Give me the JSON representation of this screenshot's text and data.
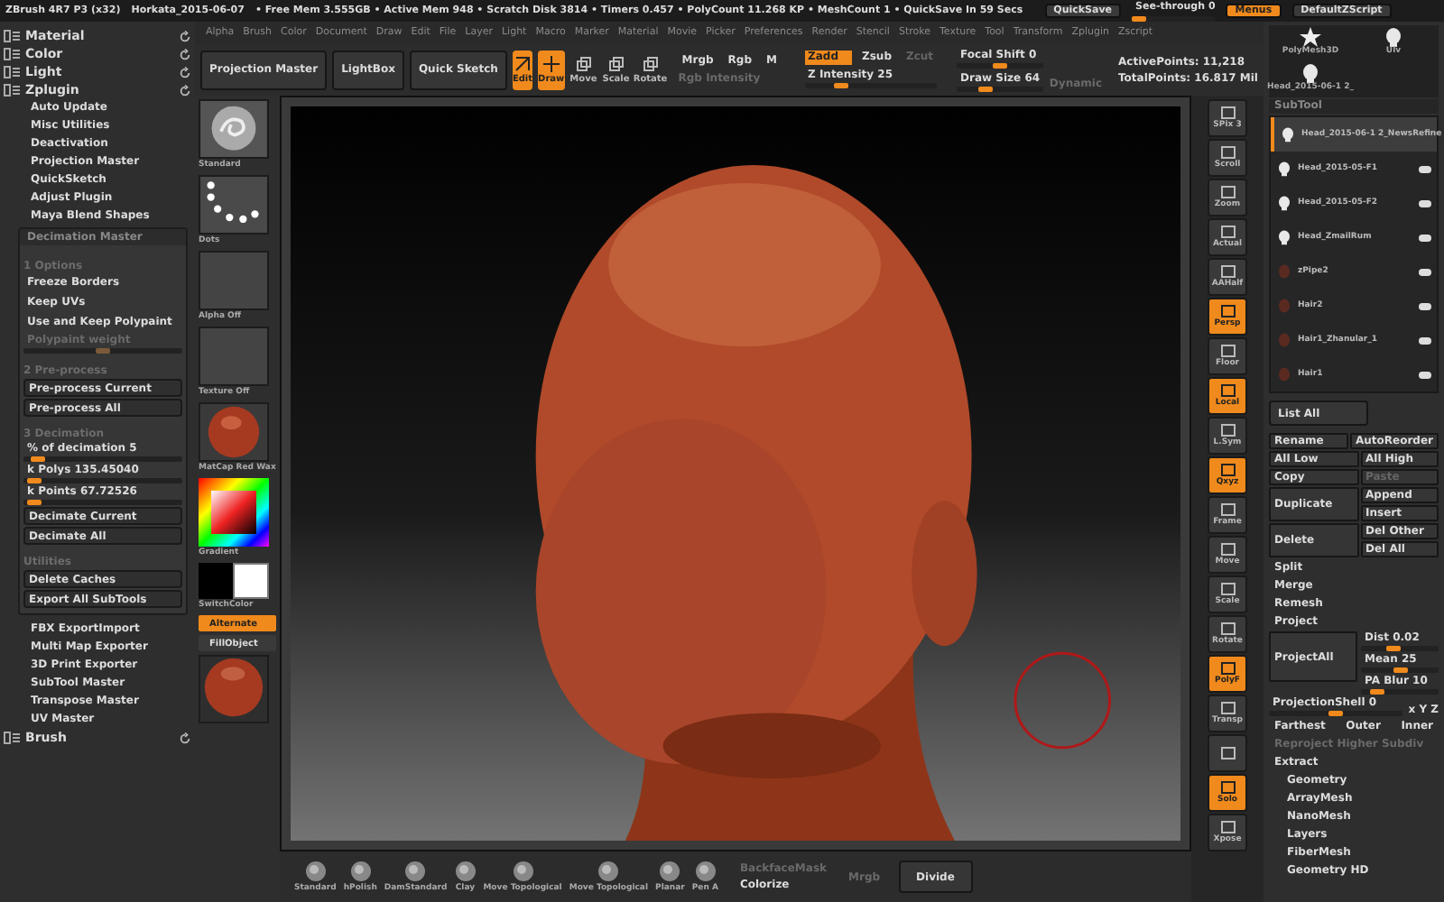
{
  "title_bar": {
    "title": "ZBrush 4R7 P3 (x32)",
    "document": "Horkata_2015-06-07",
    "stats": "• Free Mem 3.555GB • Active Mem 948 • Scratch Disk 3814 • Timers 0.457 • PolyCount 11.268 KP • MeshCount 1 • QuickSave In 59 Secs",
    "quicksave": "QuickSave",
    "see_through": {
      "label": "See-through 0",
      "level": 0
    },
    "menus": {
      "label": "Menus",
      "selected": true
    },
    "script": "DefaultZScript"
  },
  "left_palette": [
    {
      "kind": "header",
      "label": "Material"
    },
    {
      "kind": "header",
      "label": "Color"
    },
    {
      "kind": "header",
      "label": "Light"
    },
    {
      "kind": "header",
      "label": "Zplugin"
    },
    {
      "kind": "plugin",
      "label": "Auto Update"
    },
    {
      "kind": "plugin",
      "label": "Misc Utilities"
    },
    {
      "kind": "plugin",
      "label": "Deactivation"
    },
    {
      "kind": "plugin",
      "label": "Projection Master"
    },
    {
      "kind": "plugin",
      "label": "QuickSketch"
    },
    {
      "kind": "plugin",
      "label": "Adjust Plugin"
    },
    {
      "kind": "plugin",
      "label": "Maya Blend Shapes"
    },
    {
      "kind": "panel",
      "label": "Decimation Master",
      "items": [
        {
          "kind": "section",
          "label": "1 Options"
        },
        {
          "kind": "toggle",
          "label": "Freeze Borders"
        },
        {
          "kind": "toggle",
          "label": "Keep UVs"
        },
        {
          "kind": "toggle",
          "label": "Use and Keep Polypaint"
        },
        {
          "kind": "slider",
          "label": "Polypaint weight",
          "level": 0.5,
          "disabled": true
        },
        {
          "kind": "section",
          "label": "2 Pre-process"
        },
        {
          "kind": "button",
          "label": "Pre-process Current"
        },
        {
          "kind": "button",
          "label": "Pre-process All"
        },
        {
          "kind": "section",
          "label": "3 Decimation"
        },
        {
          "kind": "slider",
          "label": "% of decimation 5",
          "level": 0.05,
          "disabled": false
        },
        {
          "kind": "slider",
          "label": "k Polys 135.45040",
          "level": 0.02,
          "disabled": false
        },
        {
          "kind": "slider",
          "label": "k Points 67.72526",
          "level": 0.02,
          "disabled": false
        },
        {
          "kind": "button",
          "label": "Decimate Current"
        },
        {
          "kind": "button",
          "label": "Decimate All"
        },
        {
          "kind": "section",
          "label": "Utilities"
        },
        {
          "kind": "button",
          "label": "Delete Caches"
        },
        {
          "kind": "button",
          "label": "Export All SubTools"
        }
      ]
    },
    {
      "kind": "plugin",
      "label": "FBX ExportImport"
    },
    {
      "kind": "plugin",
      "label": "Multi Map Exporter"
    },
    {
      "kind": "plugin",
      "label": "3D Print Exporter"
    },
    {
      "kind": "plugin",
      "label": "SubTool Master"
    },
    {
      "kind": "plugin",
      "label": "Transpose Master"
    },
    {
      "kind": "plugin",
      "label": "UV Master"
    },
    {
      "kind": "header",
      "label": "Brush"
    }
  ],
  "menu_bar": [
    "Alpha",
    "Brush",
    "Color",
    "Document",
    "Draw",
    "Edit",
    "File",
    "Layer",
    "Light",
    "Macro",
    "Marker",
    "Material",
    "Movie",
    "Picker",
    "Preferences",
    "Render",
    "Stencil",
    "Stroke",
    "Texture",
    "Tool",
    "Transform",
    "Zplugin",
    "Zscript"
  ],
  "top_shelf": {
    "buttons": [
      "Projection Master",
      "LightBox",
      "Quick Sketch"
    ],
    "tools": [
      {
        "label": "Edit",
        "selected": true
      },
      {
        "label": "Draw",
        "selected": true
      },
      {
        "label": "Move",
        "selected": false
      },
      {
        "label": "Scale",
        "selected": false
      },
      {
        "label": "Rotate",
        "selected": false
      }
    ],
    "color_modes": [
      "Mrgb",
      "Rgb",
      "M"
    ],
    "rgb_intensity": {
      "label": "Rgb Intensity",
      "disabled": true
    },
    "z_modes": [
      {
        "label": "Zadd",
        "selected": true,
        "disabled": false
      },
      {
        "label": "Zsub",
        "selected": false,
        "disabled": false
      },
      {
        "label": "Zcut",
        "selected": false,
        "disabled": true
      }
    ],
    "z_intensity": {
      "label": "Z Intensity 25",
      "level": 0.25
    },
    "focal_shift": {
      "label": "Focal Shift 0",
      "level": 0.5
    },
    "draw_size": {
      "label": "Draw Size 64",
      "level": 0.3
    },
    "dynamic": "Dynamic",
    "active_points": "ActivePoints: 11,218",
    "total_points": "TotalPoints: 16.817 Mil"
  },
  "thumbnails": [
    {
      "kind": "brush",
      "label": "Standard"
    },
    {
      "kind": "stroke",
      "label": "Dots"
    },
    {
      "kind": "blank",
      "label": "Alpha Off"
    },
    {
      "kind": "blank",
      "label": "Texture Off"
    },
    {
      "kind": "material",
      "label": "MatCap Red Wax"
    },
    {
      "kind": "color",
      "label": "Gradient"
    },
    {
      "kind": "switch",
      "label": "SwitchColor"
    },
    {
      "kind": "toggle",
      "label": "Alternate",
      "on": true
    },
    {
      "kind": "button",
      "label": "FillObject"
    },
    {
      "kind": "sphere"
    }
  ],
  "bottom_shelf": {
    "brushes": [
      "Standard",
      "hPolish",
      "DamStandard",
      "Clay",
      "Move Topological",
      "Move Topological",
      "Planar",
      "Pen A"
    ],
    "backface": {
      "label": "BackfaceMask",
      "disabled": true
    },
    "colorize": "Colorize",
    "weld": {
      "label": "Mrgb",
      "disabled": true
    },
    "divide": "Divide"
  },
  "right_toolbar": [
    {
      "label": "SPix 3",
      "on": false
    },
    {
      "label": "Scroll",
      "on": false
    },
    {
      "label": "Zoom",
      "on": false
    },
    {
      "label": "Actual",
      "on": false
    },
    {
      "label": "AAHalf",
      "on": false
    },
    {
      "label": "Persp",
      "on": true
    },
    {
      "label": "Floor",
      "on": false
    },
    {
      "label": "Local",
      "on": true
    },
    {
      "label": "L.Sym",
      "on": false
    },
    {
      "label": "Qxyz",
      "on": true
    },
    {
      "label": "Frame",
      "on": false
    },
    {
      "label": "Move",
      "on": false
    },
    {
      "label": "Scale",
      "on": false
    },
    {
      "label": "Rotate",
      "on": false
    },
    {
      "label": "PolyF",
      "on": true
    },
    {
      "label": "Transp",
      "on": false
    },
    {
      "on": false
    },
    {
      "label": "Solo",
      "on": true
    },
    {
      "label": "Xpose",
      "on": false
    }
  ],
  "right_panel": {
    "tool_thumbs": [
      {
        "kind": "star",
        "label": "PolyMesh3D"
      },
      {
        "kind": "head",
        "label": "Ulv"
      },
      {
        "kind": "head",
        "label": "Head_2015-06-1 2_"
      }
    ],
    "subtool": {
      "title": "SubTool",
      "items": [
        {
          "name": "Head_2015-06-1 2_NewsRefine",
          "selected": true
        },
        {
          "name": "Head_2015-05-F1",
          "selected": false
        },
        {
          "name": "Head_2015-05-F2",
          "selected": false
        },
        {
          "name": "Head_ZmailRum",
          "selected": false
        },
        {
          "name": "zPipe2",
          "selected": false
        },
        {
          "name": "Hair2",
          "selected": false
        },
        {
          "name": "Hair1_Zhanular_1",
          "selected": false
        },
        {
          "name": "Hair1",
          "selected": false
        }
      ],
      "list_all": "List All"
    },
    "button_rows": [
      {
        "left": "Rename",
        "right": [
          {
            "label": "AutoReorder",
            "disabled": false
          }
        ]
      },
      {
        "left": "All Low",
        "right": [
          {
            "label": "All High",
            "disabled": false
          }
        ]
      },
      {
        "left": "Copy",
        "right": [
          {
            "label": "Paste",
            "disabled": true
          }
        ]
      },
      {
        "left": "Duplicate",
        "right": [
          {
            "label": "Append",
            "disabled": false
          },
          {
            "label": "Insert",
            "disabled": false
          }
        ]
      },
      {
        "left": "Delete",
        "right": [
          {
            "label": "Del Other",
            "disabled": false
          },
          {
            "label": "Del All",
            "disabled": false
          }
        ]
      }
    ],
    "actions": [
      "Split",
      "Merge",
      "Remesh"
    ],
    "project": {
      "title": "Project",
      "button": "ProjectAll",
      "sliders": [
        {
          "label": "Dist 0.02",
          "level": 0.4
        },
        {
          "label": "Mean 25",
          "level": 0.5
        },
        {
          "label": "PA Blur 10",
          "level": 0.15
        }
      ],
      "shell": {
        "label": "ProjectionShell 0",
        "level": 0.5
      },
      "shell_value": "x Y Z",
      "options": [
        "Farthest",
        "Outer",
        "Inner"
      ],
      "reproject": "Reproject Higher Subdiv"
    },
    "extract": "Extract",
    "sections": [
      "Geometry",
      "ArrayMesh",
      "NanoMesh",
      "Layers",
      "FiberMesh",
      "Geometry HD"
    ]
  }
}
